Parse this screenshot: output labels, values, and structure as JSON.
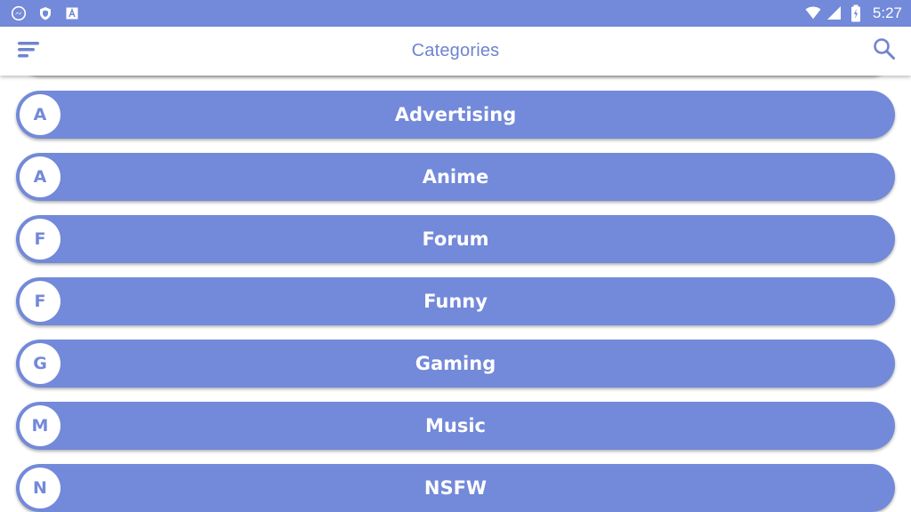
{
  "status_bar": {
    "time": "5:27",
    "left_icons": [
      "messenger-icon",
      "shield-icon",
      "a-badge-icon"
    ],
    "right_icons": [
      "wifi-icon",
      "signal-icon",
      "battery-charging-icon"
    ],
    "background": "#7389d9"
  },
  "app_bar": {
    "title": "Categories",
    "menu_icon": "sort-menu-icon",
    "search_icon": "search-icon",
    "title_color": "#6f84cf"
  },
  "categories": [
    {
      "letter": "A",
      "label": "Advertising"
    },
    {
      "letter": "A",
      "label": "Anime"
    },
    {
      "letter": "F",
      "label": "Forum"
    },
    {
      "letter": "F",
      "label": "Funny"
    },
    {
      "letter": "G",
      "label": "Gaming"
    },
    {
      "letter": "M",
      "label": "Music"
    },
    {
      "letter": "N",
      "label": "NSFW"
    }
  ],
  "colors": {
    "accent": "#7389d9",
    "item_text": "#ffffff",
    "avatar_bg": "#ffffff"
  }
}
